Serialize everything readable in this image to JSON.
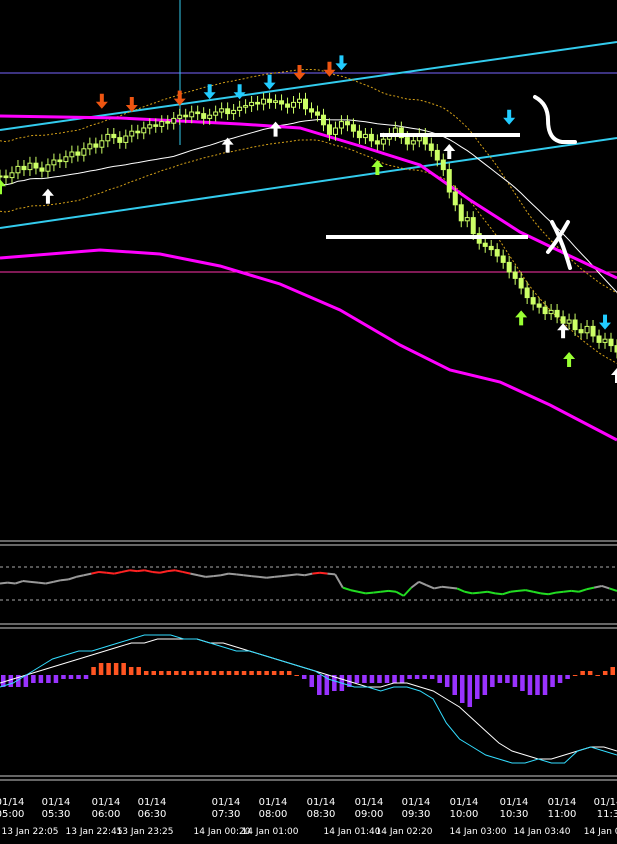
{
  "chart_data": {
    "type": "candlestick",
    "colors": {
      "background": "#000000",
      "candle": "#ccff66",
      "bb_band": "#d4a017",
      "envelope": "#ff00ff",
      "channel": "#33ccee",
      "hline_magenta": "#ff33aa",
      "ma_slow": "#ffffff",
      "arrow_up_green": "#99ff33",
      "arrow_up_white": "#ffffff",
      "arrow_down_cyan": "#22ccff",
      "arrow_down_orange": "#ee5511",
      "rsi_neutral": "#999999",
      "rsi_high": "#ff2222",
      "rsi_low": "#22dd22",
      "macd_pos": "#ff5522",
      "macd_neg": "#9933ff",
      "signal_cyan": "#33ddff",
      "signal_white": "#ffffff",
      "separator": "#cccccc"
    },
    "closes": [
      40,
      39,
      42,
      46,
      44,
      48,
      45,
      43,
      47,
      50,
      49,
      52,
      55,
      53,
      57,
      60,
      58,
      62,
      66,
      64,
      61,
      65,
      68,
      67,
      70,
      72,
      71,
      74,
      73,
      76,
      78,
      77,
      80,
      79,
      76,
      78,
      80,
      82,
      79,
      81,
      83,
      84,
      86,
      85,
      88,
      86,
      87,
      85,
      83,
      86,
      88,
      82,
      80,
      78,
      72,
      66,
      70,
      74,
      72,
      68,
      64,
      66,
      62,
      60,
      63,
      66,
      70,
      64,
      60,
      62,
      66,
      60,
      56,
      50,
      44,
      30,
      22,
      12,
      14,
      4,
      -2,
      -4,
      -6,
      -10,
      -14,
      -20,
      -24,
      -30,
      -36,
      -40,
      -42,
      -46,
      -44,
      -48,
      -52,
      -50,
      -56,
      -58,
      -54,
      -60,
      -64,
      -62,
      -66,
      -70
    ],
    "indicators": {
      "arrows_up_green": [
        [
          0,
          38
        ],
        [
          63,
          50
        ],
        [
          87,
          -44
        ],
        [
          95,
          -70
        ]
      ],
      "arrows_up_white": [
        [
          8,
          32
        ],
        [
          38,
          64
        ],
        [
          46,
          74
        ],
        [
          75,
          60
        ],
        [
          94,
          -52
        ],
        [
          103,
          -80
        ]
      ],
      "arrows_down_cyan": [
        [
          35,
          88
        ],
        [
          40,
          88
        ],
        [
          45,
          94
        ],
        [
          57,
          106
        ],
        [
          85,
          72
        ],
        [
          101,
          -56
        ]
      ],
      "arrows_down_orange": [
        [
          17,
          82
        ],
        [
          22,
          80
        ],
        [
          30,
          84
        ],
        [
          50,
          100
        ],
        [
          55,
          102
        ]
      ]
    },
    "oscillator": {
      "values": [
        50,
        51,
        50,
        53,
        52,
        51,
        50,
        52,
        54,
        55,
        58,
        60,
        62,
        64,
        63,
        62,
        64,
        66,
        65,
        66,
        64,
        63,
        65,
        66,
        64,
        62,
        60,
        58,
        59,
        60,
        62,
        61,
        60,
        59,
        58,
        57,
        58,
        59,
        60,
        61,
        60,
        62,
        63,
        62,
        61,
        45,
        42,
        40,
        38,
        39,
        40,
        41,
        40,
        35,
        45,
        52,
        48,
        44,
        46,
        45,
        44,
        40,
        38,
        39,
        40,
        38,
        37,
        40,
        41,
        42,
        40,
        38,
        37,
        39,
        40,
        41,
        40,
        43,
        45,
        47,
        44,
        41
      ],
      "levels": [
        30,
        70
      ]
    },
    "macd": {
      "histogram": [
        -3,
        -3,
        -3,
        -3,
        -2,
        -2,
        -2,
        -2,
        -1,
        -1,
        -1,
        -1,
        2,
        3,
        3,
        3,
        3,
        2,
        2,
        1,
        1,
        1,
        1,
        1,
        1,
        1,
        1,
        1,
        1,
        1,
        1,
        1,
        1,
        1,
        1,
        1,
        1,
        1,
        1,
        0,
        -1,
        -3,
        -5,
        -5,
        -4,
        -4,
        -3,
        -2,
        -2,
        -2,
        -2,
        -2,
        -2,
        -2,
        -1,
        -1,
        -1,
        -1,
        -2,
        -3,
        -5,
        -7,
        -8,
        -6,
        -5,
        -3,
        -2,
        -2,
        -3,
        -4,
        -5,
        -5,
        -5,
        -3,
        -2,
        -1,
        0,
        1,
        1,
        0,
        1,
        2
      ],
      "signal_white": [
        -2,
        -1,
        0,
        1,
        2,
        3,
        4,
        5,
        6,
        7,
        8,
        8,
        9,
        9,
        9,
        9,
        8,
        8,
        7,
        6,
        5,
        4,
        3,
        2,
        1,
        0,
        -1,
        -2,
        -3,
        -3,
        -2,
        -2,
        -3,
        -4,
        -6,
        -8,
        -11,
        -14,
        -17,
        -19,
        -20,
        -21,
        -21,
        -20,
        -19,
        -18,
        -18,
        -19
      ],
      "signal_cyan": [
        -3,
        -2,
        0,
        2,
        4,
        5,
        6,
        6,
        7,
        8,
        9,
        10,
        10,
        10,
        9,
        9,
        8,
        7,
        6,
        6,
        5,
        4,
        3,
        2,
        1,
        -1,
        -2,
        -3,
        -3,
        -4,
        -3,
        -3,
        -4,
        -6,
        -12,
        -16,
        -18,
        -20,
        -21,
        -22,
        -22,
        -21,
        -22,
        -22,
        -19,
        -18,
        -19,
        -20
      ]
    },
    "x_ticks_top": [
      "01/14\n05:00",
      "01/14\n05:30",
      "01/14\n06:00",
      "01/14\n06:30",
      "01/14\n07:30",
      "01/14\n08:00",
      "01/14\n08:30",
      "01/14\n09:00",
      "01/14\n09:30",
      "01/14\n10:00",
      "01/14\n10:30",
      "01/14\n11:00",
      "01/14\n11:3"
    ],
    "x_ticks_bottom": [
      "13 Jan 22:05",
      "13 Jan 22:45",
      "13 Jan 23:25",
      "14 Jan 00:20",
      "14 Jan 01:00",
      "14 Jan 01:40",
      "14 Jan 02:20",
      "14 Jan 03:00",
      "14 Jan 03:40",
      "14 Jan 04"
    ]
  }
}
